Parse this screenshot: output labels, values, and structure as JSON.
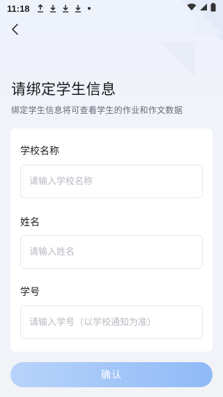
{
  "status_bar": {
    "time": "11:18"
  },
  "nav": {
    "back_icon": "chevron-left-icon"
  },
  "header": {
    "title": "请绑定学生信息",
    "subtitle": "绑定学生信息将可查看学生的作业和作文数据"
  },
  "form": {
    "school": {
      "label": "学校名称",
      "placeholder": "请输入学校名称",
      "value": ""
    },
    "name": {
      "label": "姓名",
      "placeholder": "请输入姓名",
      "value": ""
    },
    "student_id": {
      "label": "学号",
      "placeholder": "请输入学号（以学校通知为准）",
      "value": ""
    }
  },
  "actions": {
    "confirm_label": "确认"
  },
  "colors": {
    "accent": "#8fbaf6",
    "background": "#f1f3fa"
  }
}
